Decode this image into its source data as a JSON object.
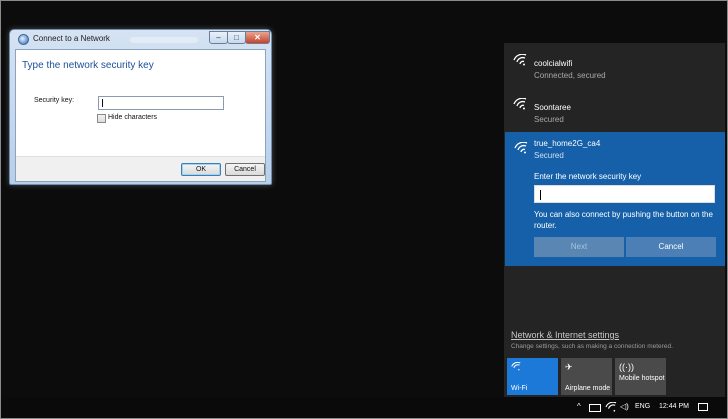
{
  "dialog": {
    "title": "Connect to a Network",
    "heading": "Type the network security key",
    "security_key_label": "Security key:",
    "security_key_value": "",
    "hide_characters_label": "Hide characters",
    "hide_characters_checked": false,
    "ok_label": "OK",
    "cancel_label": "Cancel",
    "window_buttons": {
      "minimize": "–",
      "maximize": "□",
      "close": "✕"
    }
  },
  "flyout": {
    "networks": [
      {
        "name": "coolcialwifi",
        "status": "Connected, secured"
      },
      {
        "name": "Soontaree",
        "status": "Secured"
      },
      {
        "name": "true_home2G_ca4",
        "status": "Secured"
      }
    ],
    "selected": {
      "enter_key_label": "Enter the network security key",
      "key_value": "",
      "push_button_hint": "You can also connect by pushing the button on the router.",
      "next_label": "Next",
      "cancel_label": "Cancel"
    },
    "settings_link": "Network & Internet settings",
    "settings_description": "Change settings, such as making a connection metered.",
    "quick_actions": [
      {
        "label": "Wi-Fi",
        "icon": "wifi-icon",
        "active": true
      },
      {
        "label": "Airplane mode",
        "icon": "airplane-icon",
        "active": false
      },
      {
        "label": "Mobile hotspot",
        "icon": "hotspot-icon",
        "active": false
      }
    ]
  },
  "taskbar": {
    "language": "ENG",
    "time": "12:44 PM"
  },
  "colors": {
    "flyout_bg": "#242424",
    "selected_network_bg": "#1560a8",
    "accent_tile": "#1d79d8",
    "dialog_heading": "#1c4f9a"
  }
}
